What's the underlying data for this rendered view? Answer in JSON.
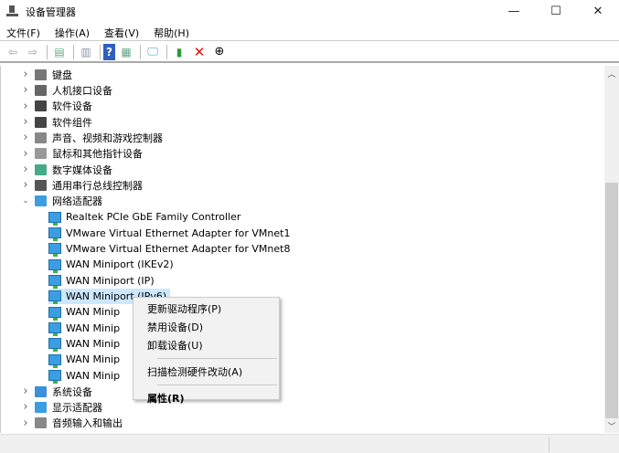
{
  "window": {
    "title": "设备管理器",
    "minimize": "—",
    "maximize": "☐",
    "close": "✕"
  },
  "menu": [
    "文件(F)",
    "操作(A)",
    "查看(V)",
    "帮助(H)"
  ],
  "toolbar": [
    "back-icon",
    "forward-icon",
    "show-hide-console-tree-icon",
    "properties-icon",
    "help-icon",
    "action-pane-icon",
    "monitor-icon",
    "update-driver-icon",
    "uninstall-icon",
    "disable-icon"
  ],
  "tree": {
    "categories_top": [
      {
        "label": "键盘",
        "color": "#777"
      },
      {
        "label": "人机接口设备",
        "color": "#666"
      },
      {
        "label": "软件设备",
        "color": "#444"
      },
      {
        "label": "软件组件",
        "color": "#444"
      },
      {
        "label": "声音、视频和游戏控制器",
        "color": "#888"
      },
      {
        "label": "鼠标和其他指针设备",
        "color": "#999"
      },
      {
        "label": "数字媒体设备",
        "color": "#4a8"
      },
      {
        "label": "通用串行总线控制器",
        "color": "#555"
      }
    ],
    "network": {
      "label": "网络适配器",
      "children": [
        "Realtek PCIe GbE Family Controller",
        "VMware Virtual Ethernet Adapter for VMnet1",
        "VMware Virtual Ethernet Adapter for VMnet8",
        "WAN Miniport (IKEv2)",
        "WAN Miniport (IP)",
        "WAN Miniport (IPv6)",
        "WAN Minip",
        "WAN Minip",
        "WAN Minip",
        "WAN Minip",
        "WAN Minip"
      ]
    },
    "categories_bottom": [
      {
        "label": "系统设备",
        "color": "#3c8fd8"
      },
      {
        "label": "显示适配器",
        "color": "#3c9ee0"
      },
      {
        "label": "音频输入和输出",
        "color": "#888"
      }
    ]
  },
  "context_menu": {
    "items": [
      "更新驱动程序(P)",
      "禁用设备(D)",
      "卸载设备(U)",
      "扫描检测硬件改动(A)",
      "属性(R)"
    ]
  }
}
